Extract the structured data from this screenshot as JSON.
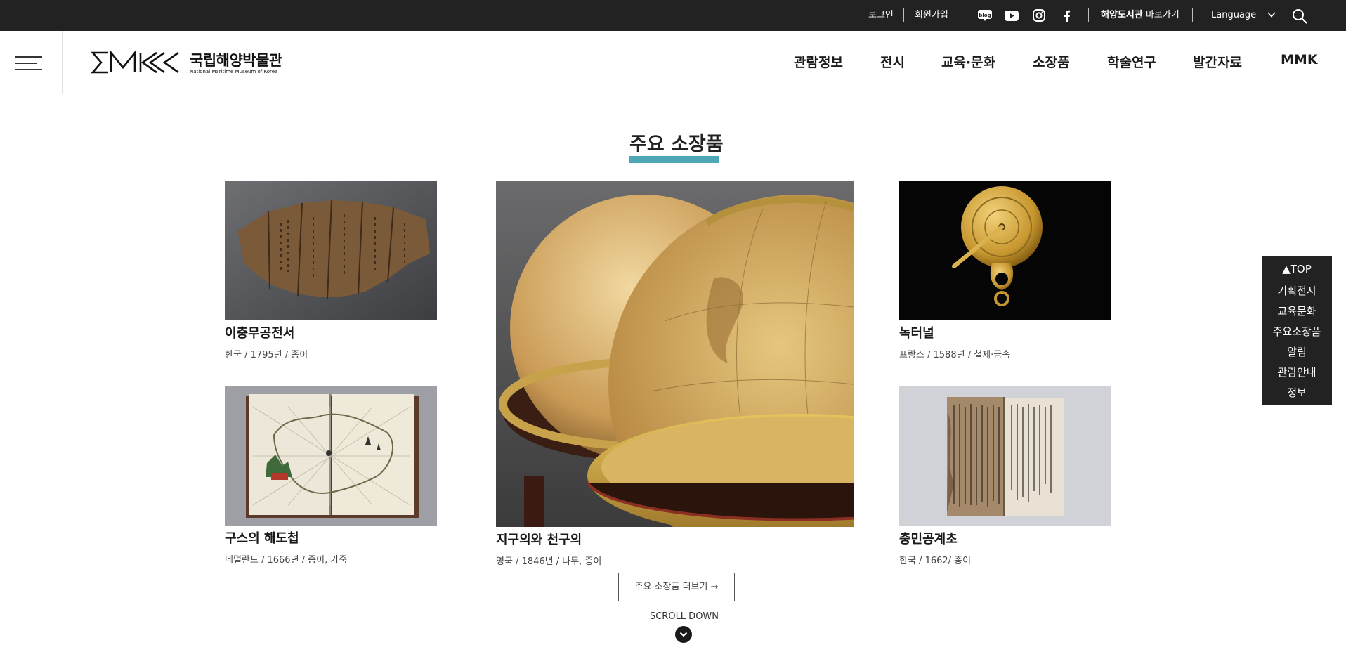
{
  "utility": {
    "login": "로그인",
    "signup": "회원가입",
    "sns": [
      "blog-icon",
      "youtube-icon",
      "instagram-icon",
      "facebook-icon"
    ],
    "library_strong": "해양도서관",
    "library_rest": " 바로가기",
    "language": "Language"
  },
  "header": {
    "logo_mark": "MMK",
    "logo_ko": "국립해양박물관",
    "logo_en": "National Maritime Museum of Korea",
    "nav": [
      "관람정보",
      "전시",
      "교육·문화",
      "소장품",
      "학술연구",
      "발간자료",
      "MMK"
    ]
  },
  "section": {
    "title": "주요 소장품",
    "accent": "#4fa6b6",
    "items": [
      {
        "title": "이충무공전서",
        "meta": "한국 / 1795년 / 종이"
      },
      {
        "title": "구스의 해도첩",
        "meta": "네덜란드 / 1666년 / 종이, 가죽"
      },
      {
        "title": "지구의와 천구의",
        "meta": "영국 / 1846년 / 나무, 종이"
      },
      {
        "title": "녹터널",
        "meta": "프랑스 / 1588년 / 철제·금속"
      },
      {
        "title": "충민공계초",
        "meta": "한국 / 1662/ 종이"
      }
    ],
    "more_button": "주요 소장품 더보기 →",
    "scroll_down": "SCROLL DOWN"
  },
  "quick_menu": [
    "▲TOP",
    "기획전시",
    "교육문화",
    "주요소장품",
    "알림",
    "관람안내",
    "정보"
  ]
}
